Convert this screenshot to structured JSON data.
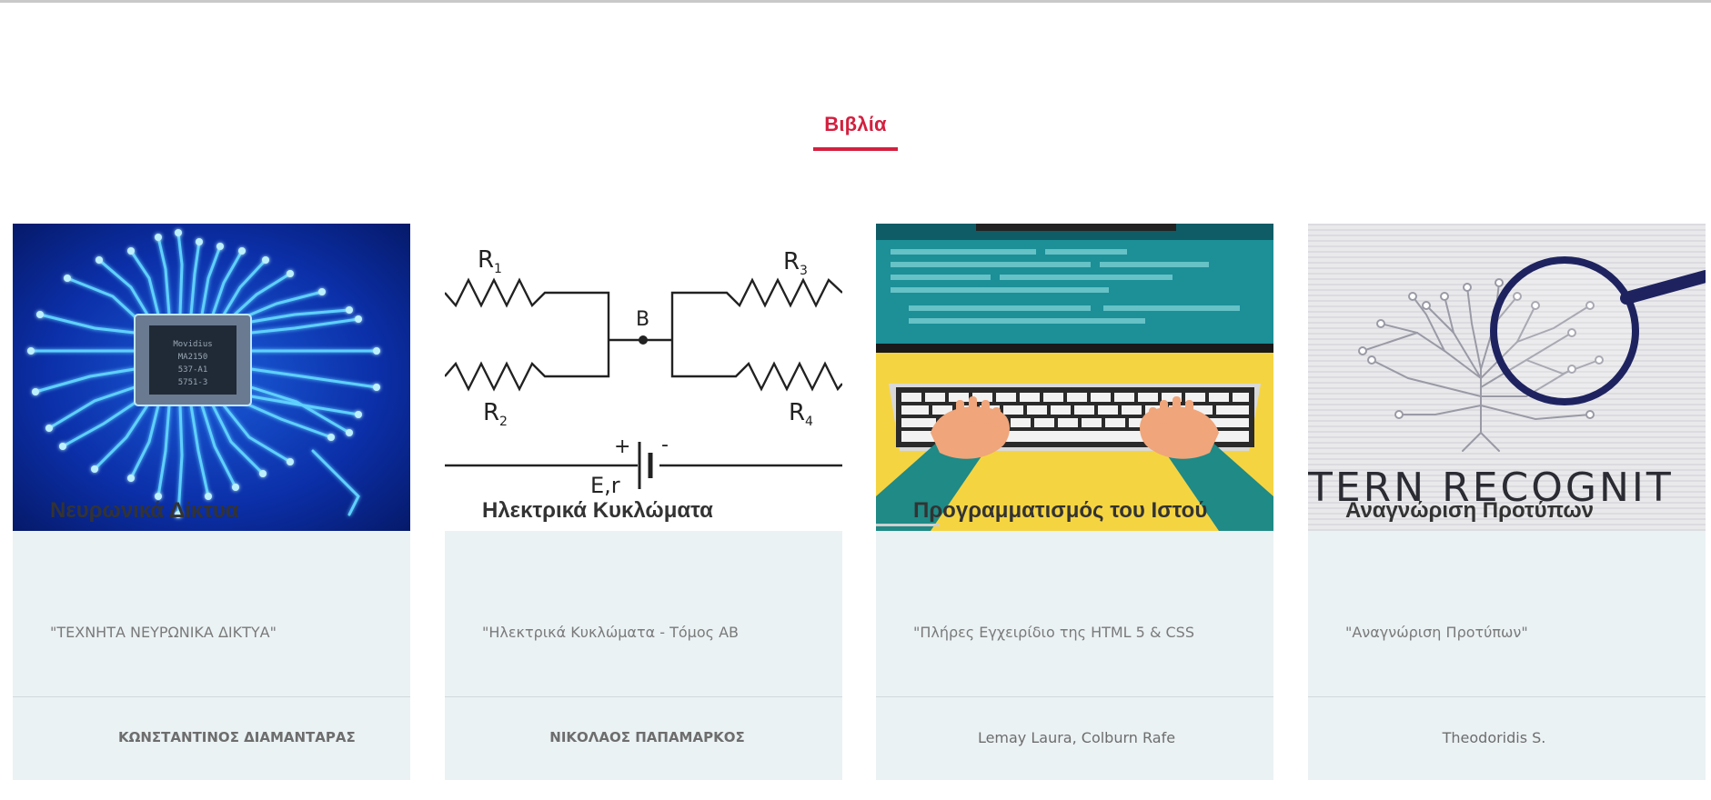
{
  "section": {
    "title": "Βιβλία"
  },
  "colors": {
    "accent": "#d3203f",
    "card_bg": "#ebf2f4",
    "title_text": "#333333",
    "muted_text": "#7a7a7a"
  },
  "cards": [
    {
      "image_icon": "circuit-chip-image",
      "title": "Νευρωνικά Δίκτυα",
      "subtitle": "\"ΤΕΧΝΗΤΑ ΝΕΥΡΩΝΙΚΑ ΔΙΚΤΥΑ\"",
      "author": "ΚΩΝΣΤΑΝΤΙΝΟΣ ΔΙΑΜΑΝΤΑΡΑΣ",
      "chip_text": [
        "Movidius",
        "MA2150",
        "537-A1",
        "5751-3"
      ]
    },
    {
      "image_icon": "electric-circuit-diagram-image",
      "title": "Ηλεκτρικά Κυκλώματα",
      "subtitle": "\"Ηλεκτρικά Κυκλώματα - Τόμος ΑΒ",
      "author": "ΝΙΚΟΛΑΟΣ ΠΑΠΑΜΑΡΚΟΣ",
      "diagram_labels": {
        "r1": "R",
        "r1_sub": "1",
        "r2": "R",
        "r2_sub": "2",
        "r3": "R",
        "r3_sub": "3",
        "r4": "R",
        "r4_sub": "4",
        "node": "B",
        "plus": "+",
        "minus": "-",
        "source": "E,r"
      }
    },
    {
      "image_icon": "laptop-typing-image",
      "title": "Προγραμματισμός του Ιστού",
      "subtitle": "\"Πλήρες Εγχειρίδιο της HTML 5 & CSS",
      "author": "Lemay Laura, Colburn Rafe"
    },
    {
      "image_icon": "pattern-recognition-image",
      "title": "Αναγνώριση Προτύπων",
      "subtitle": "\"Αναγνώριση Προτύπων\"",
      "author": "Theodoridis S.",
      "image_caption": "TERN RECOGNIT"
    }
  ]
}
